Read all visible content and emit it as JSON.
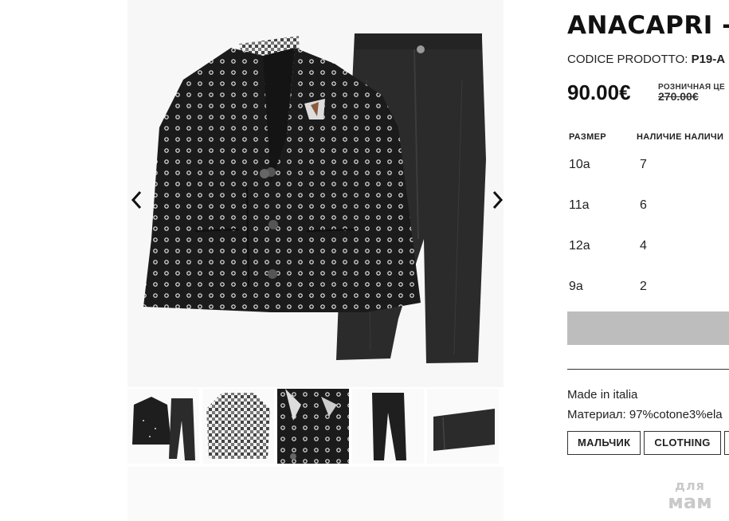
{
  "product": {
    "title": "ANACAPRI - A",
    "code_label": "CODICE PRODOTTO:",
    "code_value": "P19-A",
    "price": "90.00€",
    "retail_label": "РОЗНИЧНАЯ ЦЕ",
    "old_price": "270.00€"
  },
  "size_table": {
    "headers": {
      "size": "РАЗМЕР",
      "availability": "НАЛИЧИЕ НАЛИЧИ"
    },
    "rows": [
      {
        "size": "10a",
        "qty": "7"
      },
      {
        "size": "11a",
        "qty": "6"
      },
      {
        "size": "12a",
        "qty": "4"
      },
      {
        "size": "9a",
        "qty": "2"
      }
    ]
  },
  "details": {
    "made_in": "Made in italia",
    "material": "Материал: 97%cotone3%ela"
  },
  "tags": [
    "МАЛЬЧИК",
    "CLOTHING"
  ],
  "gallery": {
    "thumbnails": [
      "suit-full",
      "shirt",
      "jacket-detail",
      "trousers",
      "trouser-hem"
    ],
    "selected_index": 2
  },
  "watermark": {
    "top": "для",
    "bottom": "мам"
  },
  "colors": {
    "price_text": "#111111",
    "button_disabled": "#bdbdbd",
    "jacket": "#1b1b1b",
    "trousers": "#2b2b2b"
  }
}
